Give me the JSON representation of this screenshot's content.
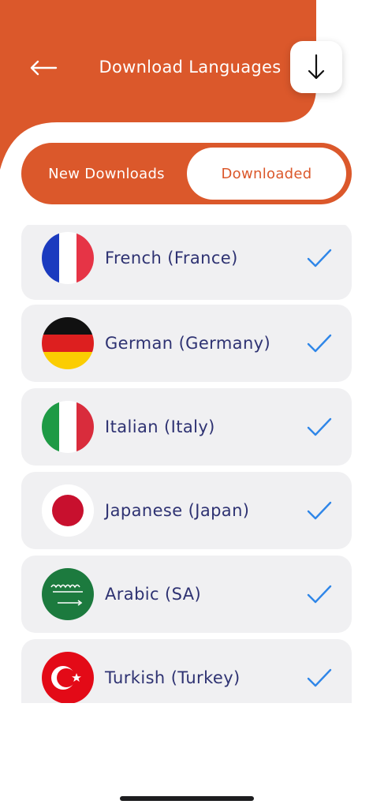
{
  "header": {
    "title": "Download Languages",
    "back_icon": "arrow-left-icon",
    "download_icon": "arrow-down-icon"
  },
  "tabs": [
    {
      "label": "New Downloads",
      "active": false
    },
    {
      "label": "Downloaded",
      "active": true
    }
  ],
  "languages": [
    {
      "name": "French (France)",
      "flag": "france-flag-icon",
      "downloaded": true
    },
    {
      "name": "German (Germany)",
      "flag": "germany-flag-icon",
      "downloaded": true
    },
    {
      "name": "Italian (Italy)",
      "flag": "italy-flag-icon",
      "downloaded": true
    },
    {
      "name": "Japanese (Japan)",
      "flag": "japan-flag-icon",
      "downloaded": true
    },
    {
      "name": "Arabic (SA)",
      "flag": "saudi-arabia-flag-icon",
      "downloaded": true
    },
    {
      "name": "Turkish (Turkey)",
      "flag": "turkey-flag-icon",
      "downloaded": true
    }
  ],
  "colors": {
    "accent": "#db582b",
    "item_background": "#f0f0f2",
    "item_text": "#2e3272",
    "check": "#2f86e8"
  }
}
